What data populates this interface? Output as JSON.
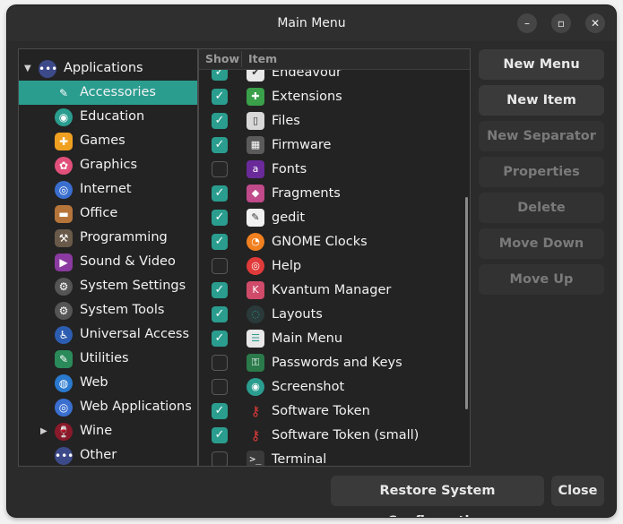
{
  "window": {
    "title": "Main Menu",
    "minimize_glyph": "–",
    "maximize_glyph": "▫",
    "close_glyph": "✕"
  },
  "tree": {
    "root": {
      "label": "Applications",
      "icon": "applications-icon",
      "expanded": true
    },
    "items": [
      {
        "label": "Accessories",
        "icon": "accessories-icon",
        "selected": true
      },
      {
        "label": "Education",
        "icon": "education-icon"
      },
      {
        "label": "Games",
        "icon": "games-icon"
      },
      {
        "label": "Graphics",
        "icon": "graphics-icon"
      },
      {
        "label": "Internet",
        "icon": "internet-icon"
      },
      {
        "label": "Office",
        "icon": "office-icon"
      },
      {
        "label": "Programming",
        "icon": "programming-icon"
      },
      {
        "label": "Sound & Video",
        "icon": "sound-video-icon"
      },
      {
        "label": "System Settings",
        "icon": "system-settings-icon"
      },
      {
        "label": "System Tools",
        "icon": "system-tools-icon"
      },
      {
        "label": "Universal Access",
        "icon": "universal-access-icon"
      },
      {
        "label": "Utilities",
        "icon": "utilities-icon"
      },
      {
        "label": "Web",
        "icon": "web-icon"
      },
      {
        "label": "Web Applications",
        "icon": "web-applications-icon"
      },
      {
        "label": "Wine",
        "icon": "wine-icon",
        "collapsed": true
      },
      {
        "label": "Other",
        "icon": "other-icon"
      }
    ]
  },
  "items_list": {
    "columns": {
      "show": "Show",
      "item": "Item"
    },
    "rows": [
      {
        "label": "Endeavour",
        "checked": true,
        "icon": "endeavour-icon"
      },
      {
        "label": "Extensions",
        "checked": true,
        "icon": "extensions-icon"
      },
      {
        "label": "Files",
        "checked": true,
        "icon": "files-icon"
      },
      {
        "label": "Firmware",
        "checked": true,
        "icon": "firmware-icon"
      },
      {
        "label": "Fonts",
        "checked": false,
        "icon": "fonts-icon"
      },
      {
        "label": "Fragments",
        "checked": true,
        "icon": "fragments-icon"
      },
      {
        "label": "gedit",
        "checked": true,
        "icon": "gedit-icon"
      },
      {
        "label": "GNOME Clocks",
        "checked": true,
        "icon": "clocks-icon"
      },
      {
        "label": "Help",
        "checked": false,
        "icon": "help-icon"
      },
      {
        "label": "Kvantum Manager",
        "checked": true,
        "icon": "kvantum-icon"
      },
      {
        "label": "Layouts",
        "checked": true,
        "icon": "layouts-icon"
      },
      {
        "label": "Main Menu",
        "checked": true,
        "icon": "main-menu-icon"
      },
      {
        "label": "Passwords and Keys",
        "checked": false,
        "icon": "passwords-keys-icon"
      },
      {
        "label": "Screenshot",
        "checked": false,
        "icon": "screenshot-icon"
      },
      {
        "label": "Software Token",
        "checked": true,
        "icon": "software-token-icon"
      },
      {
        "label": "Software Token (small)",
        "checked": true,
        "icon": "software-token-small-icon"
      },
      {
        "label": "Terminal",
        "checked": false,
        "icon": "terminal-icon"
      }
    ]
  },
  "side_buttons": [
    {
      "label": "New Menu",
      "enabled": true
    },
    {
      "label": "New Item",
      "enabled": true
    },
    {
      "label": "New Separator",
      "enabled": false
    },
    {
      "label": "Properties",
      "enabled": false
    },
    {
      "label": "Delete",
      "enabled": false
    },
    {
      "label": "Move Down",
      "enabled": false
    },
    {
      "label": "Move Up",
      "enabled": false
    }
  ],
  "bottom_buttons": {
    "restore": "Restore System Configuration",
    "close": "Close"
  },
  "colors": {
    "accent": "#2a9d8f",
    "window_bg": "#2b2b2b",
    "panel_bg": "#232323"
  },
  "glyphs": {
    "expanded": "▼",
    "collapsed": "▶",
    "check": "✓"
  }
}
